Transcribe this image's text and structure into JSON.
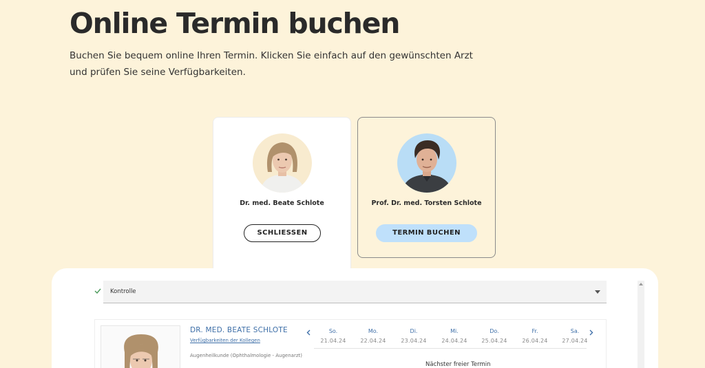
{
  "header": {
    "title": "Online Termin buchen",
    "intro": "Buchen Sie bequem online Ihren Termin. Klicken Sie einfach auf den gewünschten Arzt und prüfen Sie seine Verfügbarkeiten."
  },
  "doctors": [
    {
      "name": "Dr. med. Beate Schlote",
      "button_label": "SCHLIESSEN",
      "icon": "female-doctor-photo",
      "selected": true
    },
    {
      "name": "Prof. Dr. med. Torsten Schlote",
      "button_label": "TERMIN BUCHEN",
      "icon": "male-doctor-photo",
      "selected": false
    }
  ],
  "booking": {
    "visit_type": "Kontrolle",
    "doctor_name": "DR. MED. BEATE SCHLOTE",
    "colleagues_link": "Verfügbarkeiten der Kollegen",
    "specialty": "Augenheilkunde (Ophthalmologie - Augenarzt)",
    "days": [
      {
        "day": "So.",
        "date": "21.04.24"
      },
      {
        "day": "Mo.",
        "date": "22.04.24"
      },
      {
        "day": "Di.",
        "date": "23.04.24"
      },
      {
        "day": "Mi.",
        "date": "24.04.24"
      },
      {
        "day": "Do.",
        "date": "25.04.24"
      },
      {
        "day": "Fr.",
        "date": "26.04.24"
      },
      {
        "day": "Sa.",
        "date": "27.04.24"
      }
    ],
    "next_free": "Nächster freier Termin"
  },
  "colors": {
    "background": "#fdf3da",
    "accent_blue": "#bfe0fb",
    "link_blue": "#3e6fa8"
  }
}
